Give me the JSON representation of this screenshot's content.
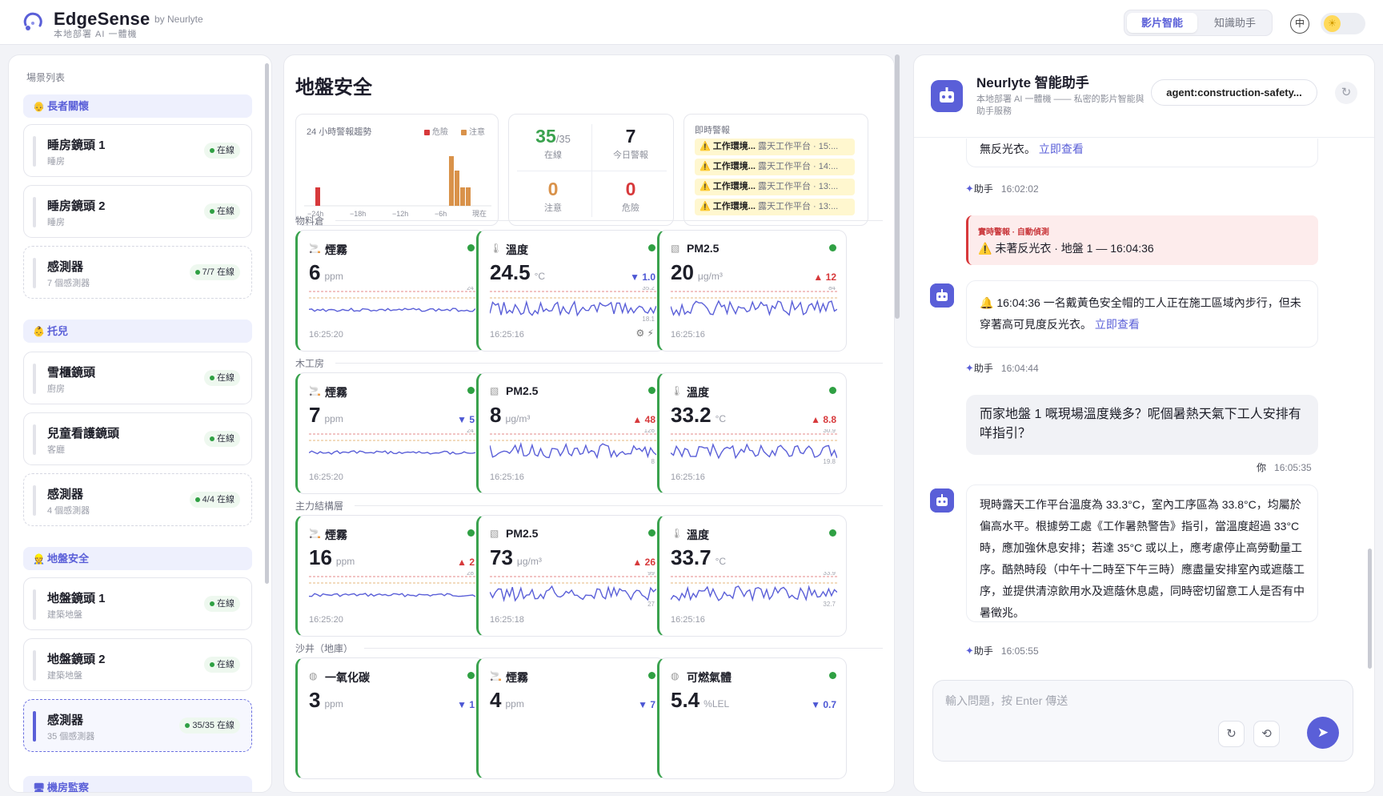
{
  "header": {
    "brand": "EdgeSense",
    "brand_by": "by Neurlyte",
    "brand_sub": "本地部署 AI 一體機",
    "modes": [
      "影片智能",
      "知識助手"
    ],
    "active_mode": "影片智能",
    "lang_label": "中",
    "icons": {
      "logo": "edge-logo-icon",
      "theme": "sun-icon"
    }
  },
  "sidebar": {
    "title": "場景列表",
    "groups": [
      {
        "label": "長者關懷",
        "icon": "elder-icon",
        "items": [
          {
            "name": "睡房鏡頭 1",
            "sub": "睡房",
            "status": "在線"
          },
          {
            "name": "睡房鏡頭 2",
            "sub": "睡房",
            "status": "在線"
          },
          {
            "name": "感測器",
            "sub": "7 個感測器",
            "status": "7/7 在線"
          }
        ]
      },
      {
        "label": "托兒",
        "icon": "child-icon",
        "items": [
          {
            "name": "雪櫃鏡頭",
            "sub": "廚房",
            "status": "在線"
          },
          {
            "name": "兒童看護鏡頭",
            "sub": "客廳",
            "status": "在線"
          },
          {
            "name": "感測器",
            "sub": "4 個感測器",
            "status": "4/4 在線"
          }
        ]
      },
      {
        "label": "地盤安全",
        "icon": "worker-icon",
        "items": [
          {
            "name": "地盤鏡頭 1",
            "sub": "建築地盤",
            "status": "在線"
          },
          {
            "name": "地盤鏡頭 2",
            "sub": "建築地盤",
            "status": "在線"
          },
          {
            "name": "感測器",
            "sub": "35 個感測器",
            "status": "35/35 在線"
          }
        ]
      },
      {
        "label": "機房監察",
        "icon": "server-icon",
        "items": []
      }
    ]
  },
  "center": {
    "title": "地盤安全",
    "trend": {
      "title": "24 小時警報趨勢",
      "legend": [
        "危險",
        "注意"
      ],
      "colors": {
        "danger": "#d7393b",
        "warning": "#d9924a"
      },
      "ticks": [
        "−24h",
        "−18h",
        "−12h",
        "−6h",
        "現在"
      ]
    },
    "stats": {
      "online": "35",
      "online_total": "/35",
      "online_label": "在線",
      "today": "7",
      "today_label": "今日警報",
      "warn": "0",
      "warn_label": "注意",
      "danger": "0",
      "danger_label": "危險"
    },
    "alerts": {
      "title": "即時警報",
      "rows": [
        {
          "t": "工作環境...",
          "m": "露天工作平台 · 15:..."
        },
        {
          "t": "工作環境...",
          "m": "露天工作平台 · 14:..."
        },
        {
          "t": "工作環境...",
          "m": "露天工作平台 · 13:..."
        },
        {
          "t": "工作環境...",
          "m": "露天工作平台 · 13:..."
        }
      ]
    },
    "sections": [
      {
        "label": "物料倉",
        "cards": [
          {
            "name": "煙霧",
            "icon": "smoke-icon",
            "value": "6",
            "unit": "ppm",
            "delta": "",
            "dir": "",
            "time": "16:25:20",
            "ref": "24",
            "low": ""
          },
          {
            "name": "溫度",
            "icon": "thermometer-icon",
            "value": "24.5",
            "unit": "°C",
            "delta": "1.0",
            "dir": "down",
            "time": "16:25:16",
            "ref": "35.2",
            "low": "18.1",
            "extra": "⚙ ⚡"
          },
          {
            "name": "PM2.5",
            "icon": "pm25-icon",
            "value": "20",
            "unit": "μg/m³",
            "delta": "12",
            "dir": "up",
            "time": "16:25:16",
            "ref": "84",
            "low": ""
          }
        ]
      },
      {
        "label": "木工房",
        "cards": [
          {
            "name": "煙霧",
            "icon": "smoke-icon",
            "value": "7",
            "unit": "ppm",
            "delta": "5",
            "dir": "down",
            "time": "16:25:20",
            "ref": "24",
            "low": ""
          },
          {
            "name": "PM2.5",
            "icon": "pm25-icon",
            "value": "8",
            "unit": "μg/m³",
            "delta": "48",
            "dir": "up",
            "time": "16:25:16",
            "ref": "126",
            "low": "8"
          },
          {
            "name": "溫度",
            "icon": "thermometer-icon",
            "value": "33.2",
            "unit": "°C",
            "delta": "8.8",
            "dir": "up",
            "time": "16:25:16",
            "ref": "30.9",
            "low": "19.8"
          }
        ]
      },
      {
        "label": "主力結構層",
        "cards": [
          {
            "name": "煙霧",
            "icon": "smoke-icon",
            "value": "16",
            "unit": "ppm",
            "delta": "2",
            "dir": "up",
            "time": "16:25:20",
            "ref": "28",
            "low": ""
          },
          {
            "name": "PM2.5",
            "icon": "pm25-icon",
            "value": "73",
            "unit": "μg/m³",
            "delta": "26",
            "dir": "up",
            "time": "16:25:18",
            "ref": "99",
            "low": "27"
          },
          {
            "name": "溫度",
            "icon": "thermometer-icon",
            "value": "33.7",
            "unit": "°C",
            "delta": "",
            "dir": "",
            "time": "16:25:16",
            "ref": "33.9",
            "low": "32.7"
          }
        ]
      },
      {
        "label": "沙井（地庫）",
        "cards": [
          {
            "name": "一氧化碳",
            "icon": "co-icon",
            "value": "3",
            "unit": "ppm",
            "delta": "1",
            "dir": "down",
            "time": "",
            "ref": "",
            "low": ""
          },
          {
            "name": "煙霧",
            "icon": "smoke-icon",
            "value": "4",
            "unit": "ppm",
            "delta": "7",
            "dir": "down",
            "time": "",
            "ref": "",
            "low": ""
          },
          {
            "name": "可燃氣體",
            "icon": "gas-icon",
            "value": "5.4",
            "unit": "%LEL",
            "delta": "0.7",
            "dir": "down",
            "time": "",
            "ref": "",
            "low": ""
          }
        ]
      }
    ]
  },
  "chat": {
    "title": "Neurlyte 智能助手",
    "subtitle": "本地部署 AI 一體機 —— 私密的影片智能與助手服務",
    "agent": "agent:construction-safety...",
    "msg1_text": "無反光衣。",
    "link": "立即查看",
    "assistant_label": "助手",
    "user_label": "你",
    "t1": "16:02:02",
    "alert_label": "實時警報 · 自動偵測",
    "alert_text": "⚠️ 未著反光衣 · 地盤 1 — 16:04:36",
    "msg2_text": "🔔 16:04:36 一名戴黃色安全帽的工人正在施工區域內步行，但未穿著高可見度反光衣。",
    "t2": "16:04:44",
    "user_msg": "而家地盤 1 嘅現場溫度幾多？呢個暑熱天氣下工人安排有咩指引？",
    "t3": "16:05:35",
    "msg3_text": "現時露天工作平台溫度為 33.3°C，室內工序區為 33.8°C，均屬於偏高水平。根據勞工處《工作暑熱警告》指引，當溫度超過 33°C 時，應加強休息安排；若達 35°C 或以上，應考慮停止高勞動量工序。酷熱時段（中午十二時至下午三時）應盡量安排室內或遮蔭工序，並提供清涼飲用水及遮蔭休息處，同時密切留意工人是否有中暑徵兆。",
    "t4": "16:05:55",
    "input_placeholder": "輸入問題，按 Enter 傳送"
  }
}
